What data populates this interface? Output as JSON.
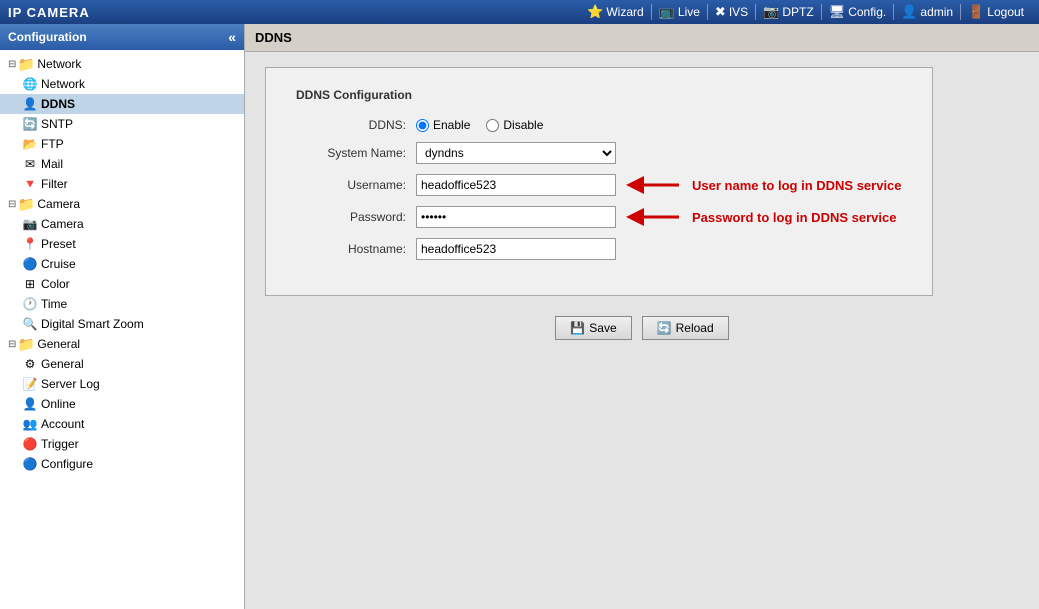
{
  "topbar": {
    "title": "IP CAMERA",
    "nav_items": [
      {
        "id": "wizard",
        "label": "Wizard",
        "icon": "⭐"
      },
      {
        "id": "live",
        "label": "Live",
        "icon": "🖥"
      },
      {
        "id": "ivs",
        "label": "IVS",
        "icon": "✖"
      },
      {
        "id": "dptz",
        "label": "DPTZ",
        "icon": "📷"
      },
      {
        "id": "config",
        "label": "Config.",
        "icon": "🖥"
      },
      {
        "id": "admin",
        "label": "admin",
        "icon": "👤"
      },
      {
        "id": "logout",
        "label": "Logout",
        "icon": "🚪"
      }
    ]
  },
  "sidebar": {
    "header": "Configuration",
    "collapse_btn": "«",
    "tree": {
      "network_group": "Network",
      "network_item": "Network",
      "ddns_item": "DDNS",
      "sntp_item": "SNTP",
      "ftp_item": "FTP",
      "mail_item": "Mail",
      "filter_item": "Filter",
      "camera_group": "Camera",
      "camera_item": "Camera",
      "preset_item": "Preset",
      "cruise_item": "Cruise",
      "color_item": "Color",
      "time_item": "Time",
      "digital_zoom_item": "Digital Smart Zoom",
      "general_group": "General",
      "general_item": "General",
      "server_log_item": "Server Log",
      "online_item": "Online",
      "account_item": "Account",
      "trigger_item": "Trigger",
      "configure_item": "Configure"
    }
  },
  "content": {
    "header": "DDNS",
    "config_box_title": "DDNS Configuration",
    "form": {
      "ddns_label": "DDNS:",
      "enable_label": "Enable",
      "disable_label": "Disable",
      "system_name_label": "System Name:",
      "system_name_value": "dyndns",
      "username_label": "Username:",
      "username_value": "headoffice523",
      "password_label": "Password:",
      "password_value": "******",
      "hostname_label": "Hostname:",
      "hostname_value": "headoffice523",
      "annotation_username": "User name to log in DDNS service",
      "annotation_password": "Password to log in DDNS service"
    },
    "buttons": {
      "save_label": "Save",
      "reload_label": "Reload"
    }
  }
}
